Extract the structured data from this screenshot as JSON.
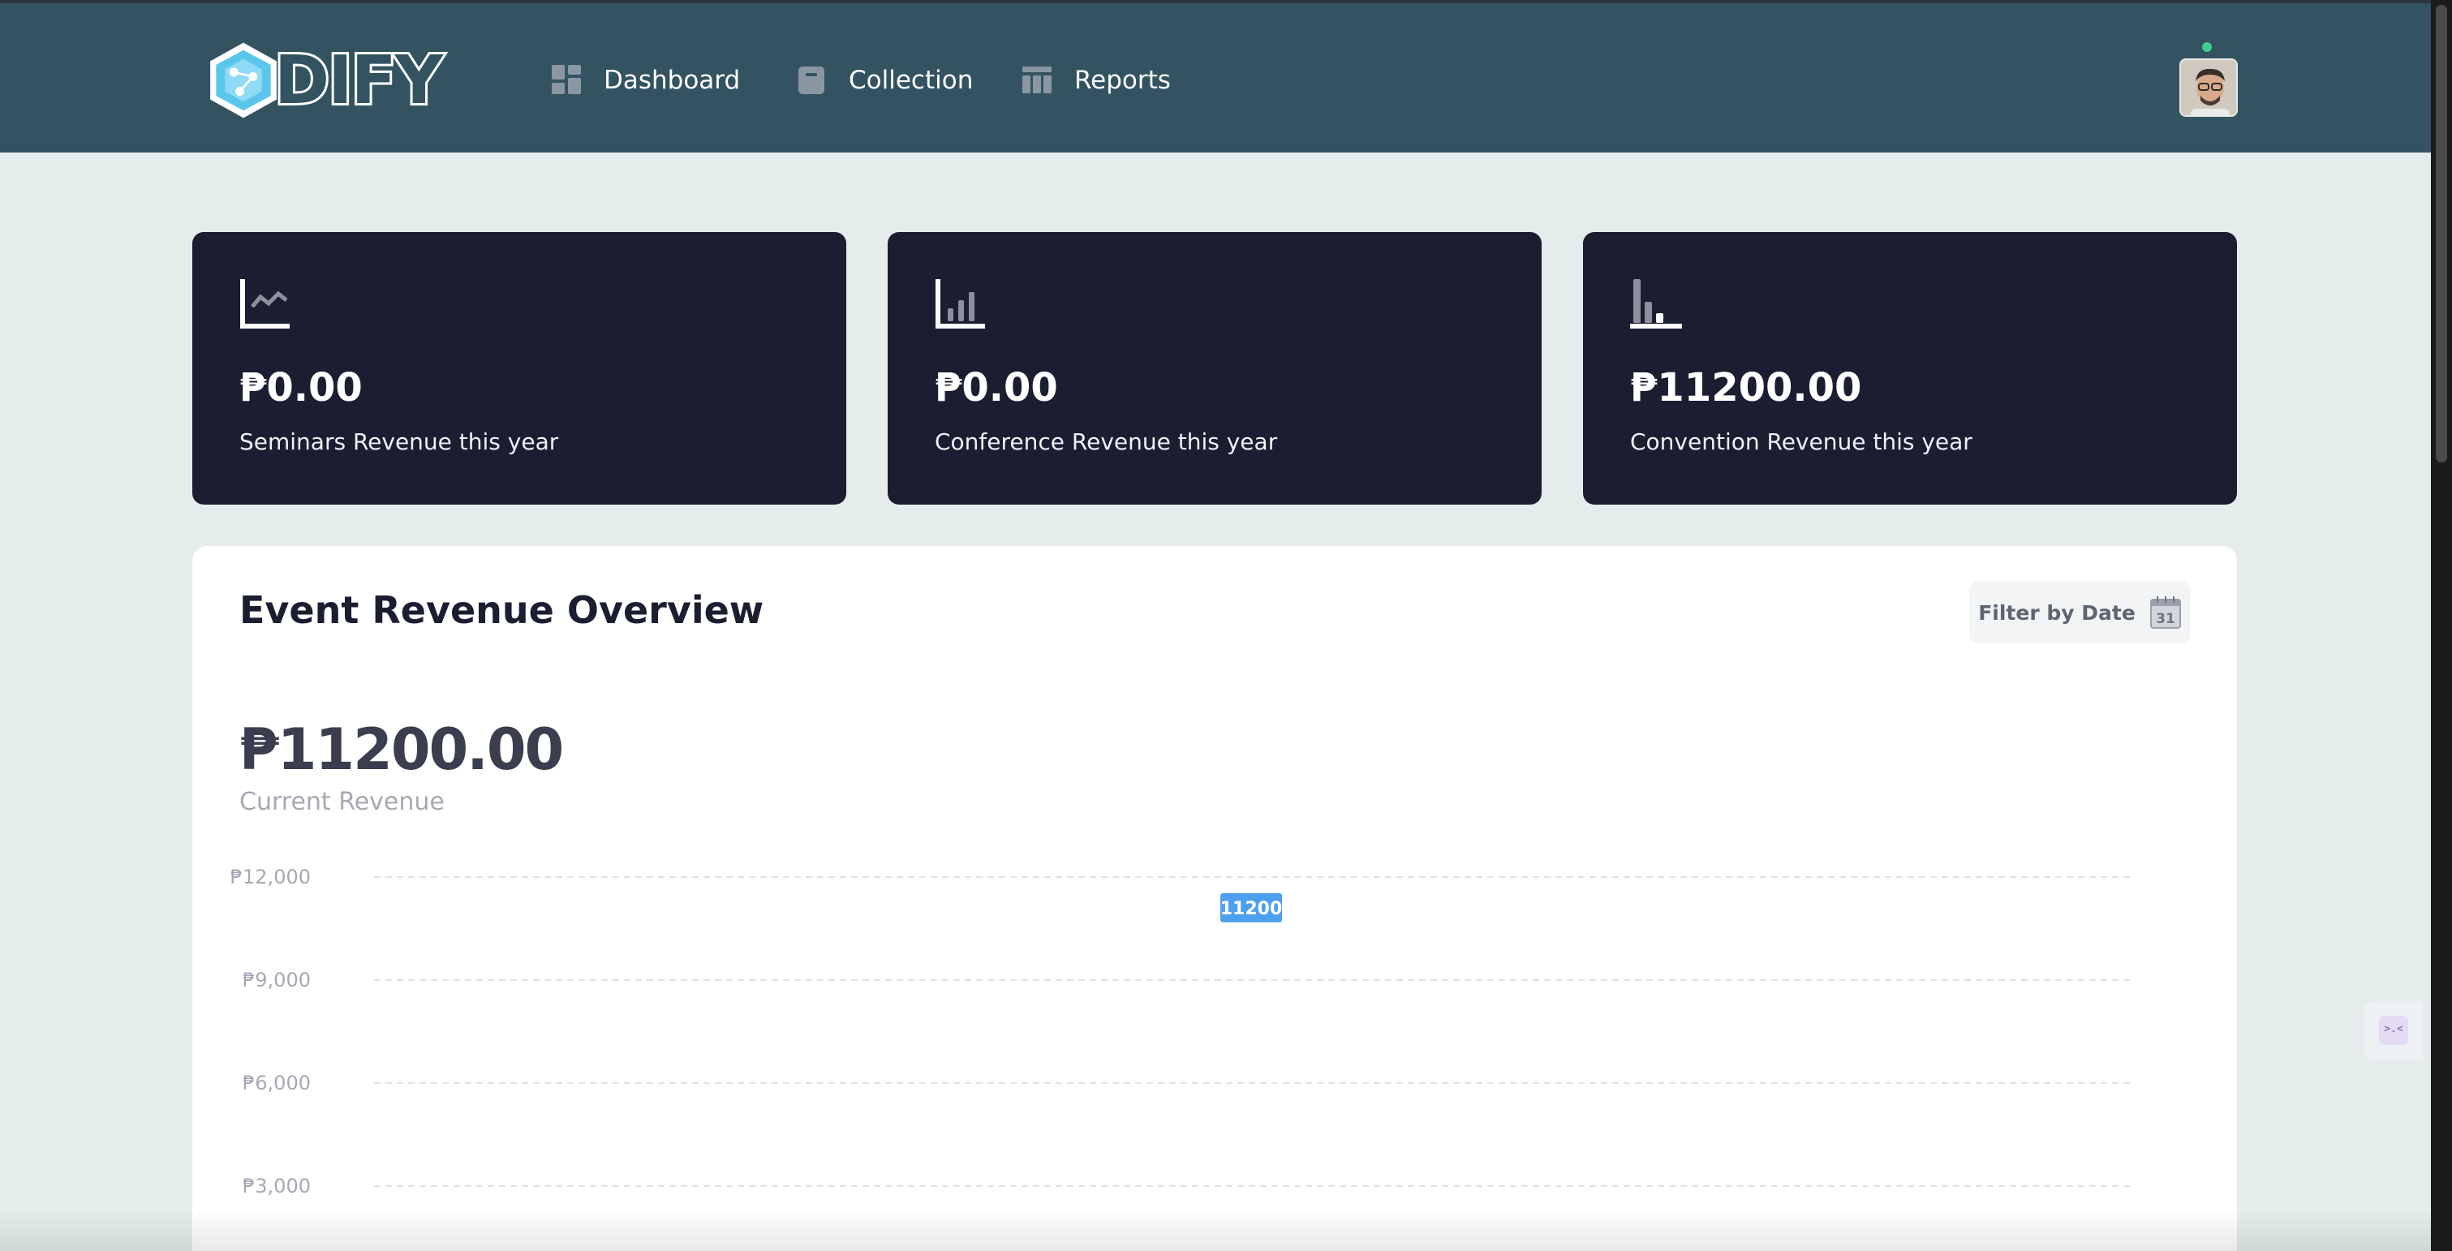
{
  "brand": {
    "logo_text": "DIFY"
  },
  "nav": {
    "items": [
      {
        "label": "Dashboard",
        "icon": "dashboard-grid-icon"
      },
      {
        "label": "Collection",
        "icon": "archive-box-icon"
      },
      {
        "label": "Reports",
        "icon": "table-icon"
      }
    ]
  },
  "user": {
    "avatar": "user-avatar",
    "status_color": "#3ecf8e"
  },
  "cards": [
    {
      "amount": "₱0.00",
      "label": "Seminars Revenue this year",
      "icon": "line-chart-icon"
    },
    {
      "amount": "₱0.00",
      "label": "Conference Revenue this year",
      "icon": "bar-chart-icon"
    },
    {
      "amount": "₱11200.00",
      "label": "Convention Revenue this year",
      "icon": "descending-bars-icon"
    }
  ],
  "overview": {
    "title": "Event Revenue Overview",
    "filter_label": "Filter by Date",
    "filter_icon_day": "31",
    "current_amount": "₱11200.00",
    "current_label": "Current Revenue"
  },
  "chart_data": {
    "type": "bar",
    "y_tick_labels": [
      "₱12,000",
      "₱9,000",
      "₱6,000",
      "₱3,000"
    ],
    "y_ticks": [
      12000,
      9000,
      6000,
      3000
    ],
    "points": [
      {
        "value": 11200,
        "label": "11200",
        "position": 0.5
      }
    ],
    "ylim": [
      0,
      12000
    ],
    "grid": true,
    "label_color": "#4d9ff0"
  },
  "colors": {
    "topbar": "#345360",
    "card": "#1b1d31",
    "page_bg": "#e4edec",
    "accent": "#4d9ff0"
  }
}
